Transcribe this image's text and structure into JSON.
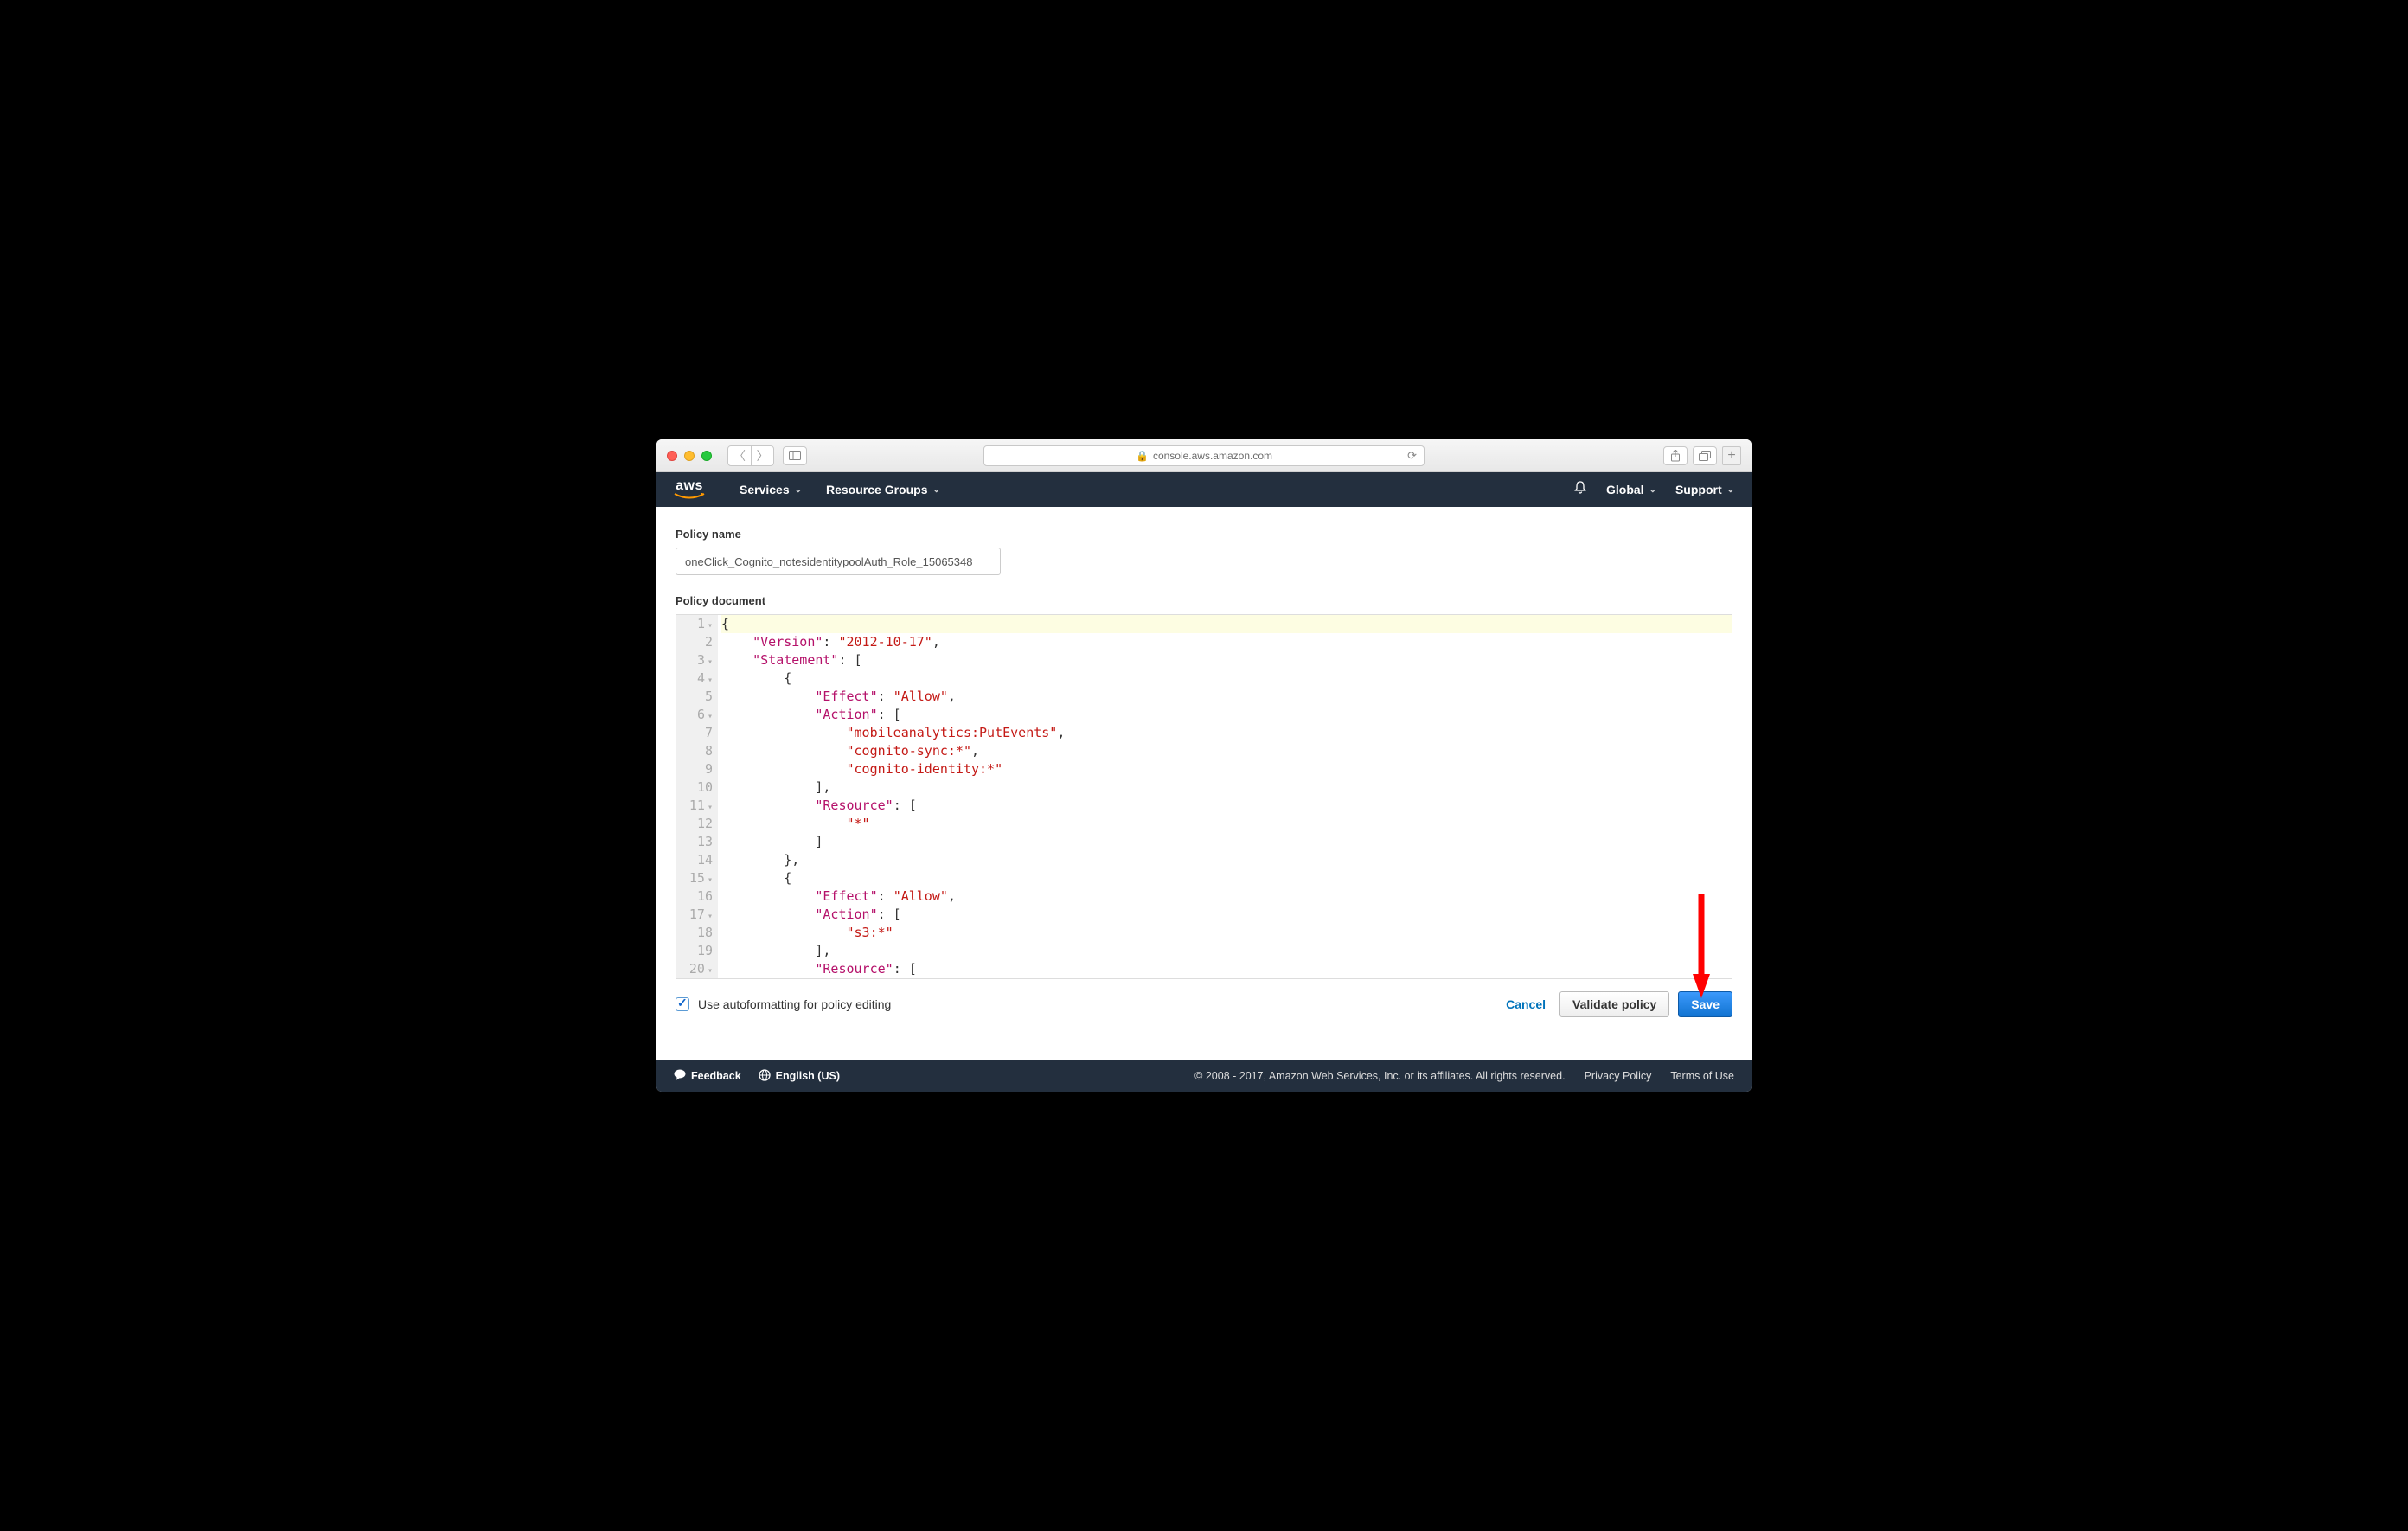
{
  "browser": {
    "url": "console.aws.amazon.com"
  },
  "header": {
    "services": "Services",
    "resource_groups": "Resource Groups",
    "region": "Global",
    "support": "Support"
  },
  "form": {
    "policy_name_label": "Policy name",
    "policy_name_value": "oneClick_Cognito_notesidentitypoolAuth_Role_15065348",
    "policy_document_label": "Policy document",
    "autoformat_label": "Use autoformatting for policy editing",
    "autoformat_checked": true
  },
  "buttons": {
    "cancel": "Cancel",
    "validate": "Validate policy",
    "save": "Save"
  },
  "editor": {
    "lines": [
      {
        "n": 1,
        "fold": true,
        "hl": true,
        "segments": [
          {
            "t": "{",
            "c": "pun"
          }
        ]
      },
      {
        "n": 2,
        "segments": [
          {
            "t": "    ",
            "c": ""
          },
          {
            "t": "\"Version\"",
            "c": "key"
          },
          {
            "t": ": ",
            "c": "pun"
          },
          {
            "t": "\"2012-10-17\"",
            "c": "str"
          },
          {
            "t": ",",
            "c": "pun"
          }
        ]
      },
      {
        "n": 3,
        "fold": true,
        "segments": [
          {
            "t": "    ",
            "c": ""
          },
          {
            "t": "\"Statement\"",
            "c": "key"
          },
          {
            "t": ": [",
            "c": "pun"
          }
        ]
      },
      {
        "n": 4,
        "fold": true,
        "segments": [
          {
            "t": "        ",
            "c": ""
          },
          {
            "t": "{",
            "c": "pun"
          }
        ]
      },
      {
        "n": 5,
        "segments": [
          {
            "t": "            ",
            "c": ""
          },
          {
            "t": "\"Effect\"",
            "c": "key"
          },
          {
            "t": ": ",
            "c": "pun"
          },
          {
            "t": "\"Allow\"",
            "c": "str"
          },
          {
            "t": ",",
            "c": "pun"
          }
        ]
      },
      {
        "n": 6,
        "fold": true,
        "segments": [
          {
            "t": "            ",
            "c": ""
          },
          {
            "t": "\"Action\"",
            "c": "key"
          },
          {
            "t": ": [",
            "c": "pun"
          }
        ]
      },
      {
        "n": 7,
        "segments": [
          {
            "t": "                ",
            "c": ""
          },
          {
            "t": "\"mobileanalytics:PutEvents\"",
            "c": "str"
          },
          {
            "t": ",",
            "c": "pun"
          }
        ]
      },
      {
        "n": 8,
        "segments": [
          {
            "t": "                ",
            "c": ""
          },
          {
            "t": "\"cognito-sync:*\"",
            "c": "str"
          },
          {
            "t": ",",
            "c": "pun"
          }
        ]
      },
      {
        "n": 9,
        "segments": [
          {
            "t": "                ",
            "c": ""
          },
          {
            "t": "\"cognito-identity:*\"",
            "c": "str"
          }
        ]
      },
      {
        "n": 10,
        "segments": [
          {
            "t": "            ",
            "c": ""
          },
          {
            "t": "],",
            "c": "pun"
          }
        ]
      },
      {
        "n": 11,
        "fold": true,
        "segments": [
          {
            "t": "            ",
            "c": ""
          },
          {
            "t": "\"Resource\"",
            "c": "key"
          },
          {
            "t": ": [",
            "c": "pun"
          }
        ]
      },
      {
        "n": 12,
        "segments": [
          {
            "t": "                ",
            "c": ""
          },
          {
            "t": "\"*\"",
            "c": "str"
          }
        ]
      },
      {
        "n": 13,
        "segments": [
          {
            "t": "            ",
            "c": ""
          },
          {
            "t": "]",
            "c": "pun"
          }
        ]
      },
      {
        "n": 14,
        "segments": [
          {
            "t": "        ",
            "c": ""
          },
          {
            "t": "},",
            "c": "pun"
          }
        ]
      },
      {
        "n": 15,
        "fold": true,
        "segments": [
          {
            "t": "        ",
            "c": ""
          },
          {
            "t": "{",
            "c": "pun"
          }
        ]
      },
      {
        "n": 16,
        "segments": [
          {
            "t": "            ",
            "c": ""
          },
          {
            "t": "\"Effect\"",
            "c": "key"
          },
          {
            "t": ": ",
            "c": "pun"
          },
          {
            "t": "\"Allow\"",
            "c": "str"
          },
          {
            "t": ",",
            "c": "pun"
          }
        ]
      },
      {
        "n": 17,
        "fold": true,
        "segments": [
          {
            "t": "            ",
            "c": ""
          },
          {
            "t": "\"Action\"",
            "c": "key"
          },
          {
            "t": ": [",
            "c": "pun"
          }
        ]
      },
      {
        "n": 18,
        "segments": [
          {
            "t": "                ",
            "c": ""
          },
          {
            "t": "\"s3:*\"",
            "c": "str"
          }
        ]
      },
      {
        "n": 19,
        "segments": [
          {
            "t": "            ",
            "c": ""
          },
          {
            "t": "],",
            "c": "pun"
          }
        ]
      },
      {
        "n": 20,
        "fold": true,
        "segments": [
          {
            "t": "            ",
            "c": ""
          },
          {
            "t": "\"Resource\"",
            "c": "key"
          },
          {
            "t": ": [",
            "c": "pun"
          }
        ]
      }
    ]
  },
  "footer": {
    "feedback": "Feedback",
    "language": "English (US)",
    "copyright": "© 2008 - 2017, Amazon Web Services, Inc. or its affiliates. All rights reserved.",
    "privacy": "Privacy Policy",
    "terms": "Terms of Use"
  }
}
